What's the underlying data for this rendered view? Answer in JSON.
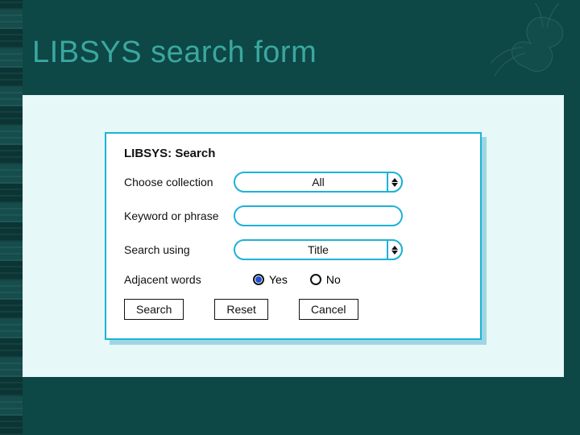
{
  "slide": {
    "title": "LIBSYS search form"
  },
  "form": {
    "title": "LIBSYS: Search",
    "labels": {
      "collection": "Choose collection",
      "keyword": "Keyword or phrase",
      "search_using": "Search using",
      "adjacent": "Adjacent words"
    },
    "values": {
      "collection": "All",
      "keyword": "",
      "search_using": "Title"
    },
    "radio": {
      "yes": "Yes",
      "no": "No",
      "selected": "yes"
    },
    "buttons": {
      "search": "Search",
      "reset": "Reset",
      "cancel": "Cancel"
    }
  },
  "colors": {
    "background": "#0d4746",
    "accent": "#1eb2d6",
    "panel_bg": "#e6f8f8",
    "title": "#3aa7a0"
  }
}
